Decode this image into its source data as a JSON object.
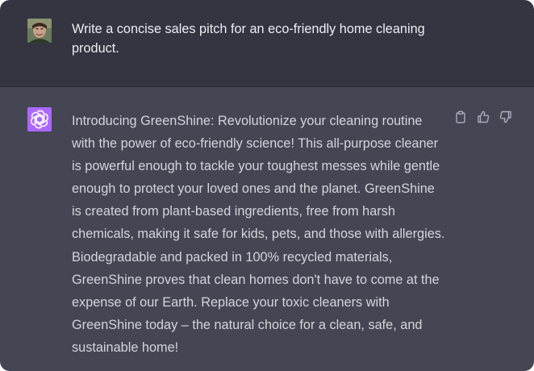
{
  "conversation": {
    "user_message": "Write a concise sales pitch for an eco-friendly home cleaning product.",
    "assistant_message": "Introducing GreenShine: Revolutionize your cleaning routine with the power of eco-friendly science! This all-purpose cleaner is powerful enough to tackle your toughest messes while gentle enough to protect your loved ones and the planet. GreenShine is created from plant-based ingredients, free from harsh chemicals, making it safe for kids, pets, and those with allergies. Biodegradable and packed in 100% recycled materials, GreenShine proves that clean homes don't have to come at the expense of our Earth. Replace your toxic cleaners with GreenShine today – the natural choice for a clean, safe, and sustainable home!"
  },
  "icons": {
    "user_avatar": "user-avatar-photo",
    "assistant_avatar": "openai-logo-icon",
    "copy": "clipboard-icon",
    "like": "thumbs-up-icon",
    "dislike": "thumbs-down-icon"
  },
  "colors": {
    "user_bg": "#343541",
    "assistant_bg": "#444654",
    "assistant_avatar_bg": "#ab68ff",
    "text": "#ececf1"
  }
}
